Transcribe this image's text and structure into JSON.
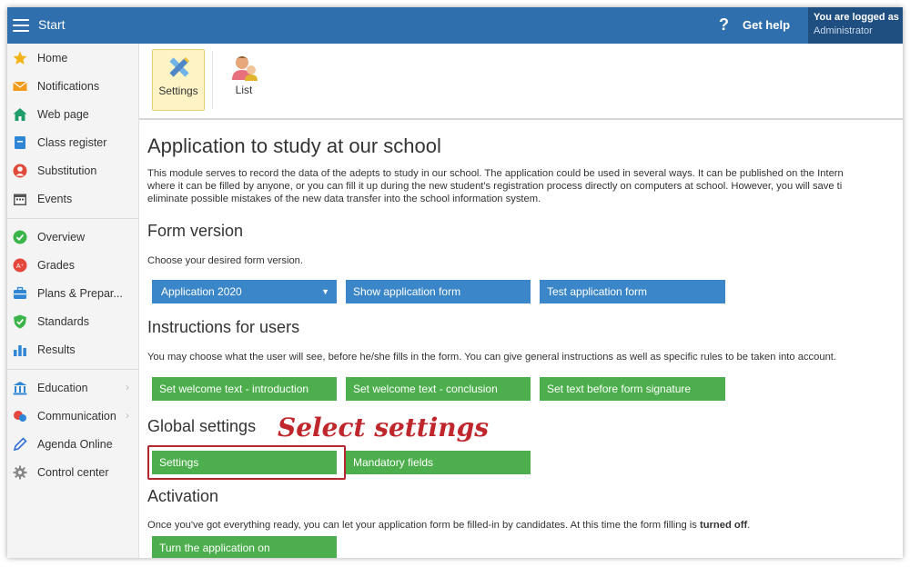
{
  "topbar": {
    "title": "Start",
    "help_label": "Get help",
    "help_symbol": "?",
    "login_line1": "You are logged as",
    "login_line2": "Administrator",
    "color": "#2f6fad"
  },
  "sidebar": {
    "items": [
      {
        "label": "Home",
        "icon": "star-icon"
      },
      {
        "label": "Notifications",
        "icon": "envelope-icon"
      },
      {
        "label": "Web page",
        "icon": "house-icon"
      },
      {
        "label": "Class register",
        "icon": "book-icon"
      },
      {
        "label": "Substitution",
        "icon": "person-icon"
      },
      {
        "label": "Events",
        "icon": "calendar-icon"
      },
      {
        "label": "Overview",
        "icon": "check-circle-icon"
      },
      {
        "label": "Grades",
        "icon": "grade-icon"
      },
      {
        "label": "Plans & Prepar...",
        "icon": "briefcase-icon"
      },
      {
        "label": "Standards",
        "icon": "shield-check-icon"
      },
      {
        "label": "Results",
        "icon": "bar-chart-icon"
      },
      {
        "label": "Education",
        "icon": "school-icon"
      },
      {
        "label": "Communication",
        "icon": "chat-icon"
      },
      {
        "label": "Agenda Online",
        "icon": "pen-icon"
      },
      {
        "label": "Control center",
        "icon": "gear-icon"
      }
    ]
  },
  "toolbar": {
    "settings_label": "Settings",
    "list_label": "List"
  },
  "main": {
    "title": "Application to study at our school",
    "intro": [
      "This module serves to record the data of the adepts to study in our school. The application could be used in several ways. It can be published on the Intern",
      "where it can be filled by anyone, or you can fill it up during the new student's registration process directly on computers at school. However, you will save ti",
      "eliminate possible mistakes of the new data transfer into the school information system."
    ],
    "form_version": {
      "heading": "Form version",
      "description": "Choose your desired form version.",
      "select_value": "Application 2020",
      "show_button": "Show application form",
      "test_button": "Test application form"
    },
    "instructions": {
      "heading": "Instructions for users",
      "description": "You may choose what the user will see, before he/she fills in the form. You can give general instructions as well as specific rules to be taken into account.",
      "welcome_intro_button": "Set welcome text - introduction",
      "welcome_conclusion_button": "Set welcome text - conclusion",
      "signature_button": "Set text before form signature"
    },
    "global_settings": {
      "heading": "Global settings",
      "settings_button": "Settings",
      "mandatory_button": "Mandatory fields"
    },
    "activation": {
      "heading": "Activation",
      "description_prefix": "Once you've got everything ready, you can let your application form be filled-in by candidates. At this time the form filling is ",
      "description_bold": "turned off",
      "description_suffix": ".",
      "turn_on_button": "Turn the application on"
    },
    "annotation": "Select settings"
  }
}
